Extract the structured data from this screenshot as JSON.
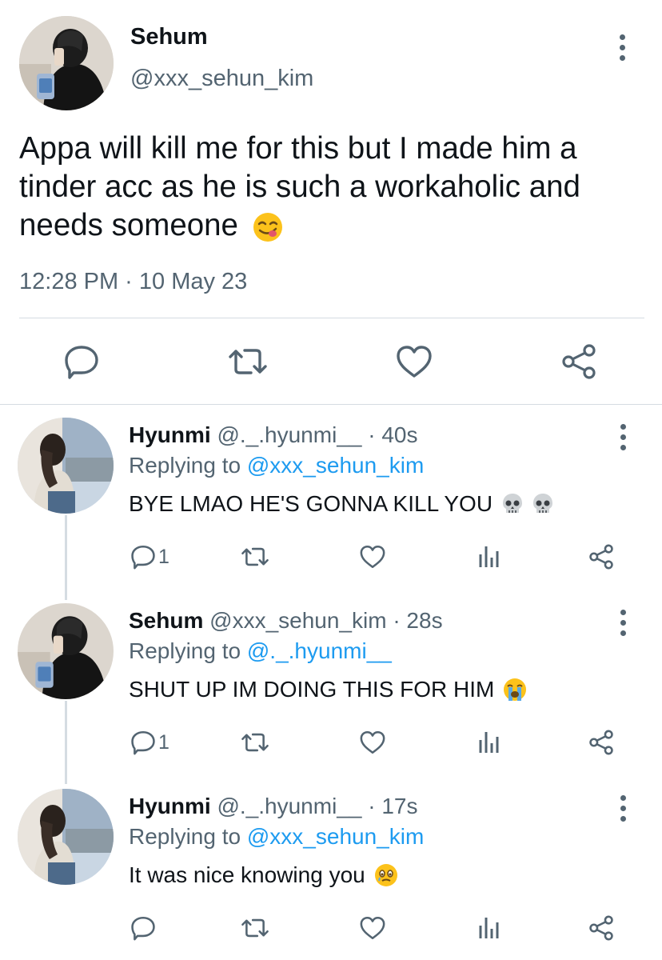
{
  "main_tweet": {
    "author_name": "Sehum",
    "author_handle": "@xxx_sehun_kim",
    "text": "Appa will kill me for this but I made him a tinder acc as he is such a workaholic and needs someone",
    "text_emoji": "savoring-food-face-emoji",
    "timestamp": "12:28 PM · 10 May 23",
    "actions": [
      "reply-icon",
      "retweet-icon",
      "like-icon",
      "share-icon"
    ]
  },
  "replies": [
    {
      "author_name": "Hyunmi",
      "author_handle": "@._.hyunmi__",
      "age": "· 40s",
      "replying_prefix": "Replying to",
      "replying_to": "@xxx_sehun_kim",
      "text": "BYE LMAO HE'S GONNA KILL YOU",
      "text_emoji": [
        "skull-emoji",
        "skull-emoji"
      ],
      "reply_count": "1"
    },
    {
      "author_name": "Sehum",
      "author_handle": "@xxx_sehun_kim",
      "age": "· 28s",
      "replying_prefix": "Replying to",
      "replying_to": "@._.hyunmi__",
      "text": "SHUT UP IM DOING THIS FOR HIM",
      "text_emoji": [
        "loudly-crying-face-emoji"
      ],
      "reply_count": "1"
    },
    {
      "author_name": "Hyunmi",
      "author_handle": "@._.hyunmi__",
      "age": "· 17s",
      "replying_prefix": "Replying to",
      "replying_to": "@xxx_sehun_kim",
      "text": "It was nice knowing you",
      "text_emoji": [
        "face-holding-back-tears-emoji"
      ],
      "reply_count": ""
    }
  ],
  "colors": {
    "text": "#0f1419",
    "secondary": "#536471",
    "link": "#1d9bf0",
    "divider": "#d5dce2",
    "emoji_yellow": "#fcc21b"
  }
}
